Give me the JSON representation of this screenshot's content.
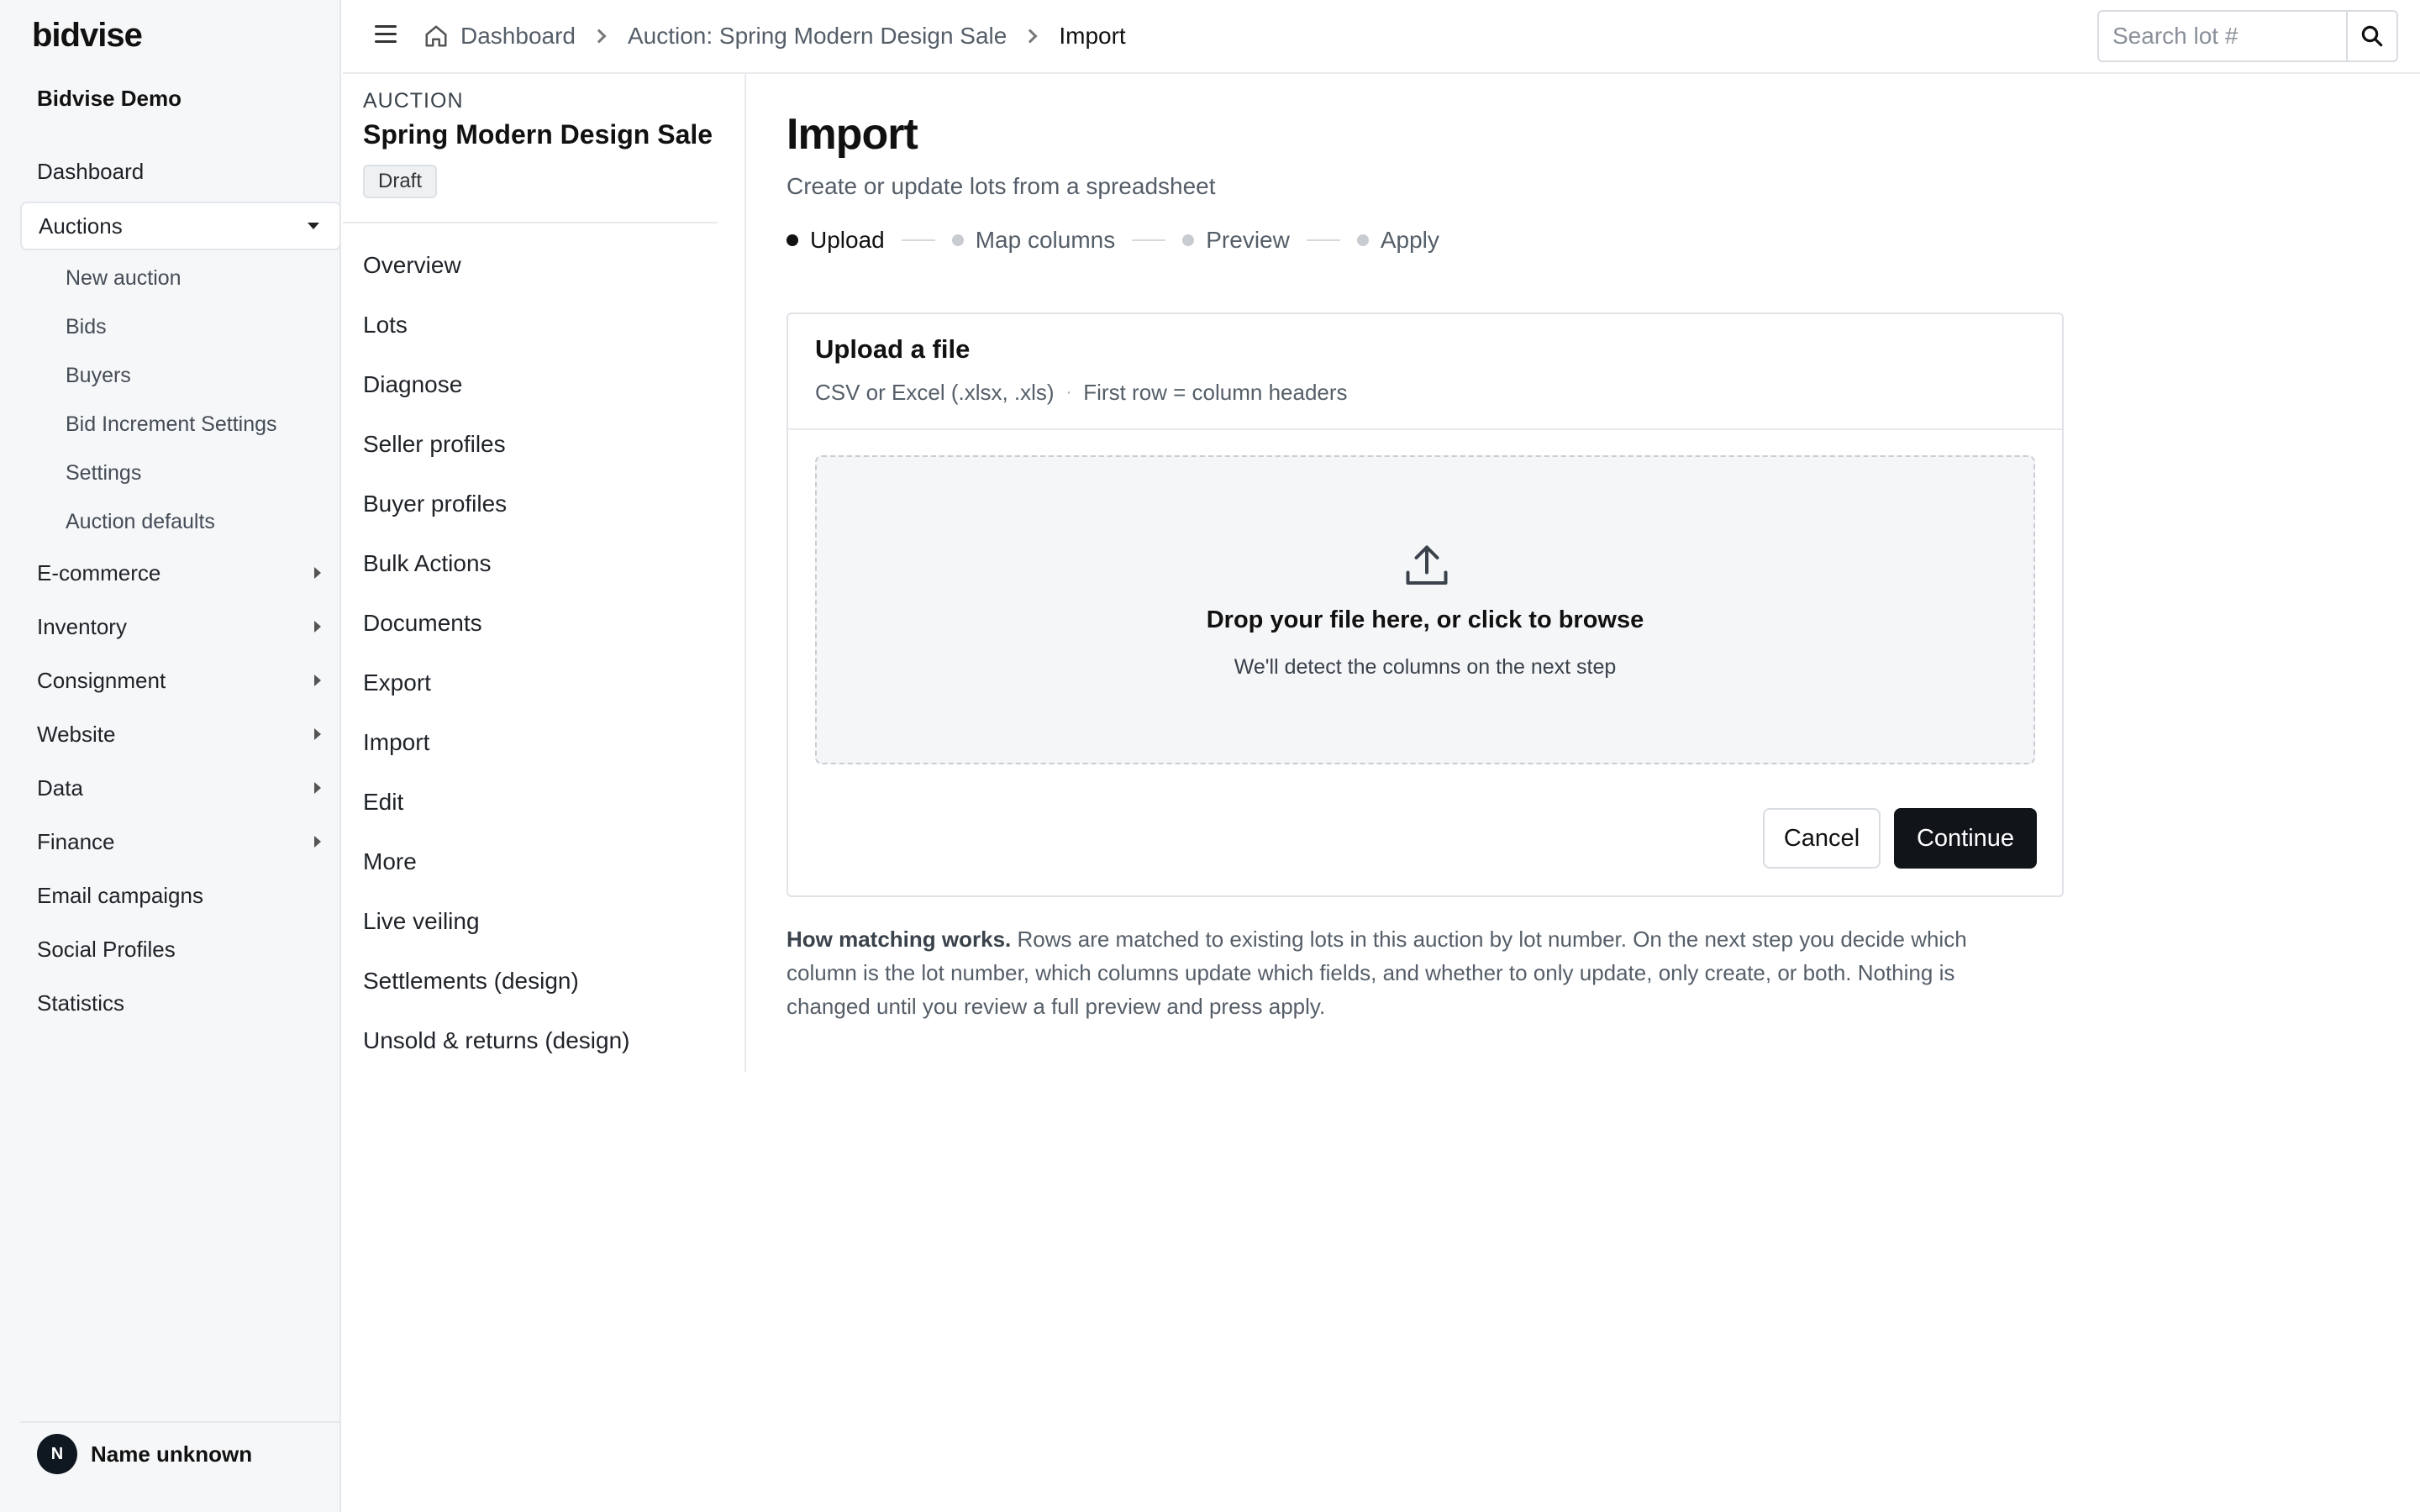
{
  "sidebar": {
    "brand": "bidvise",
    "org_name": "Bidvise Demo",
    "items": [
      {
        "label": "Dashboard"
      },
      {
        "label": "Auctions",
        "expanded": true,
        "children": [
          "New auction",
          "Bids",
          "Buyers",
          "Bid Increment Settings",
          "Settings",
          "Auction defaults"
        ]
      },
      {
        "label": "E-commerce"
      },
      {
        "label": "Inventory"
      },
      {
        "label": "Consignment"
      },
      {
        "label": "Website"
      },
      {
        "label": "Data"
      },
      {
        "label": "Finance"
      },
      {
        "label": "Email campaigns"
      },
      {
        "label": "Social Profiles"
      },
      {
        "label": "Statistics"
      }
    ],
    "user": {
      "initial": "N",
      "name": "Name unknown"
    }
  },
  "topbar": {
    "breadcrumbs": [
      "Dashboard",
      "Auction: Spring Modern Design Sale",
      "Import"
    ],
    "search_placeholder": "Search lot #"
  },
  "auction": {
    "eyebrow": "AUCTION",
    "title": "Spring Modern Design Sale",
    "status": "Draft",
    "menu": [
      "Overview",
      "Lots",
      "Diagnose",
      "Seller profiles",
      "Buyer profiles",
      "Bulk Actions",
      "Documents",
      "Export",
      "Import",
      "Edit",
      "More",
      "Live veiling",
      "Settlements (design)",
      "Unsold & returns (design)"
    ]
  },
  "main": {
    "title": "Import",
    "subtitle": "Create or update lots from a spreadsheet",
    "steps": [
      "Upload",
      "Map columns",
      "Preview",
      "Apply"
    ],
    "active_step": 0,
    "card": {
      "title": "Upload a file",
      "formats": "CSV or Excel (.xlsx, .xls)",
      "bullet": "·",
      "header_note": "First row = column headers",
      "drop_title": "Drop your file here, or click to browse",
      "drop_sub": "We'll detect the columns on the next step",
      "cancel": "Cancel",
      "continue": "Continue"
    },
    "help_title": "How matching works.",
    "help_text": "Rows are matched to existing lots in this auction by lot number. On the next step you decide which column is the lot number, which columns update which fields, and whether to only update, only create, or both. Nothing is changed until you review a full preview and press apply."
  },
  "colors": {
    "primary_button": "#11151a",
    "sidebar_bg": "#f6f7f9",
    "border": "#dfe2e6"
  }
}
